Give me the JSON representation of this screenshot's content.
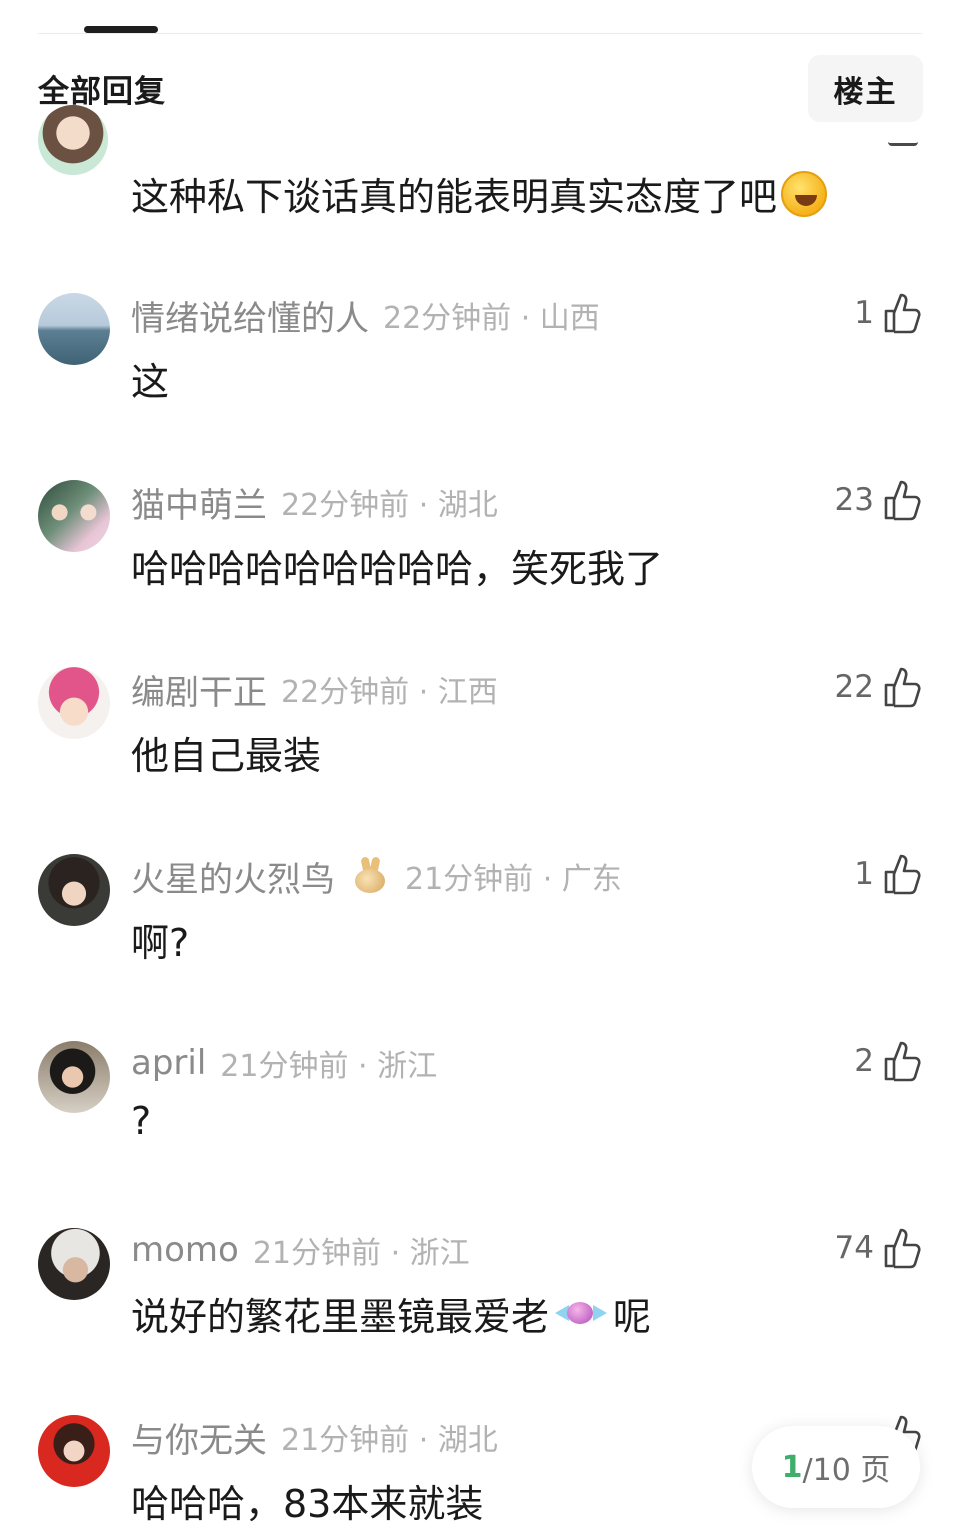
{
  "header": {
    "title": "全部回复",
    "owner_button": "楼主"
  },
  "partial_comment": {
    "content": "这种私下谈话真的能表明真实态度了吧",
    "emoji": "rofl-emoji"
  },
  "comments": [
    {
      "username": "情绪说给懂的人",
      "time": "22分钟前",
      "location": "山西",
      "likes": "1",
      "content": "这",
      "avatar": "sea-horizon"
    },
    {
      "username": "猫中萌兰",
      "time": "22分钟前",
      "location": "湖北",
      "likes": "23",
      "content": "哈哈哈哈哈哈哈哈哈，笑死我了",
      "avatar": "wedding-couple"
    },
    {
      "username": "编剧干正",
      "time": "22分钟前",
      "location": "江西",
      "likes": "22",
      "content": "他自己最装",
      "avatar": "anime-pink-hair"
    },
    {
      "username": "火星的火烈鸟",
      "time": "21分钟前",
      "location": "广东",
      "likes": "1",
      "content": "啊?",
      "avatar": "vintage-portrait",
      "badge": "rabbit-badge"
    },
    {
      "username": "april",
      "time": "21分钟前",
      "location": "浙江",
      "likes": "2",
      "content": "?",
      "avatar": "woman-dark-hair"
    },
    {
      "username": "momo",
      "time": "21分钟前",
      "location": "浙江",
      "likes": "74",
      "content_before": "说好的繁花里墨镜最爱老",
      "content_after": "呢",
      "content_emoji": "candy-emoji",
      "avatar": "silver-hair"
    },
    {
      "username": "与你无关",
      "time": "21分钟前",
      "location": "湖北",
      "likes": "",
      "content": "哈哈哈，83本来就装",
      "avatar": "red-bg-woman"
    }
  ],
  "pager": {
    "current": "1",
    "total_label": "/10 页"
  },
  "colors": {
    "username": "#8a8a8a",
    "meta": "#b2b2b2",
    "pager_accent": "#3fae6a",
    "text": "#1a1a1a"
  }
}
